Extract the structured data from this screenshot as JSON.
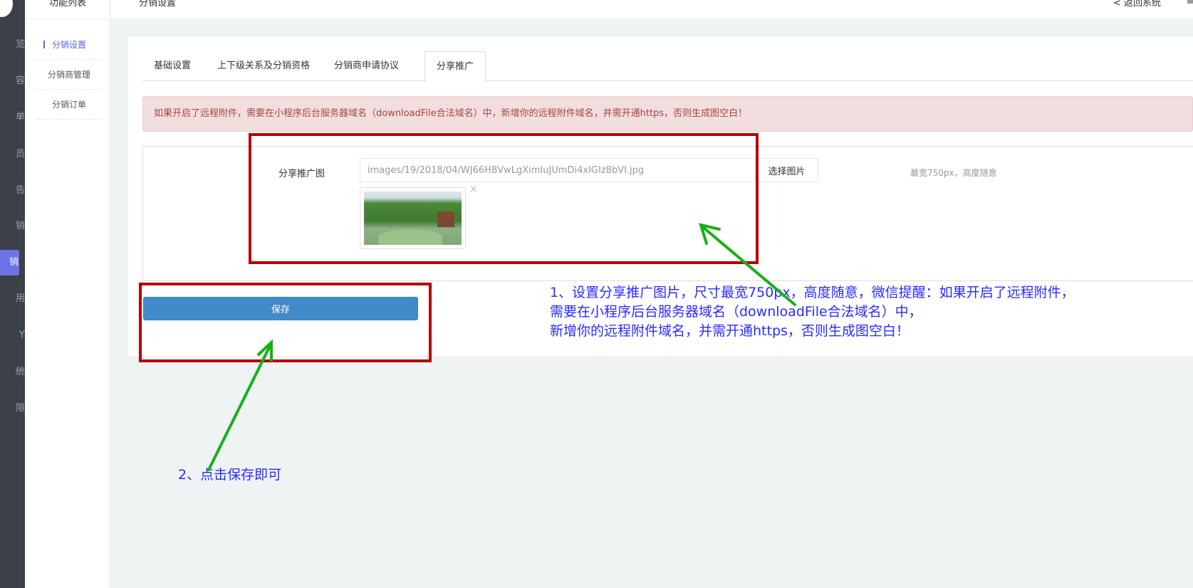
{
  "main_nav": {
    "items": [
      {
        "label": "览",
        "active": false
      },
      {
        "label": "容",
        "active": false
      },
      {
        "label": "单",
        "active": false
      },
      {
        "label": "员",
        "active": false
      },
      {
        "label": "告",
        "active": false
      },
      {
        "label": "销",
        "active": false
      },
      {
        "label": "销",
        "active": true
      },
      {
        "label": "用",
        "active": false
      },
      {
        "label": "Y",
        "active": false
      },
      {
        "label": "统",
        "active": false
      },
      {
        "label": "限",
        "active": false
      }
    ],
    "active_color": "#6c73e6"
  },
  "sub_nav": {
    "title": "功能列表",
    "items": [
      {
        "label": "分销设置",
        "active": true
      },
      {
        "label": "分销商管理",
        "active": false
      },
      {
        "label": "分销订单",
        "active": false
      }
    ]
  },
  "header": {
    "title": "分销设置",
    "back_label": "< 返回系统",
    "user_icon": "user-icon"
  },
  "tabs": [
    {
      "label": "基础设置",
      "active": false
    },
    {
      "label": "上下级关系及分销资格",
      "active": false
    },
    {
      "label": "分销商申请协议",
      "active": false
    },
    {
      "label": "分享推广",
      "active": true
    }
  ],
  "alert": "如果开启了远程附件，需要在小程序后台服务器域名（downloadFile合法域名）中，新增你的远程附件域名，并需开通https，否则生成图空白！",
  "form": {
    "label": "分享推广图",
    "path_value": "images/19/2018/04/WJ66H8VwLgXimIuJUmDi4xIGIz8bVI.jpg",
    "pick_button": "选择图片",
    "hint": "最宽750px，高度随意",
    "remove_icon": "×",
    "save_button": "保存"
  },
  "annotations": {
    "note1": [
      "1、设置分享推广图片，尺寸最宽750px，高度随意，微信提醒：如果开启了远程附件，",
      "需要在小程序后台服务器域名（downloadFile合法域名）中，",
      "新增你的远程附件域名，并需开通https，否则生成图空白！"
    ],
    "note2": "2、点击保存即可",
    "box_color": "#b80000",
    "arrow_color": "#16b116",
    "text_color": "#2a2aff"
  }
}
